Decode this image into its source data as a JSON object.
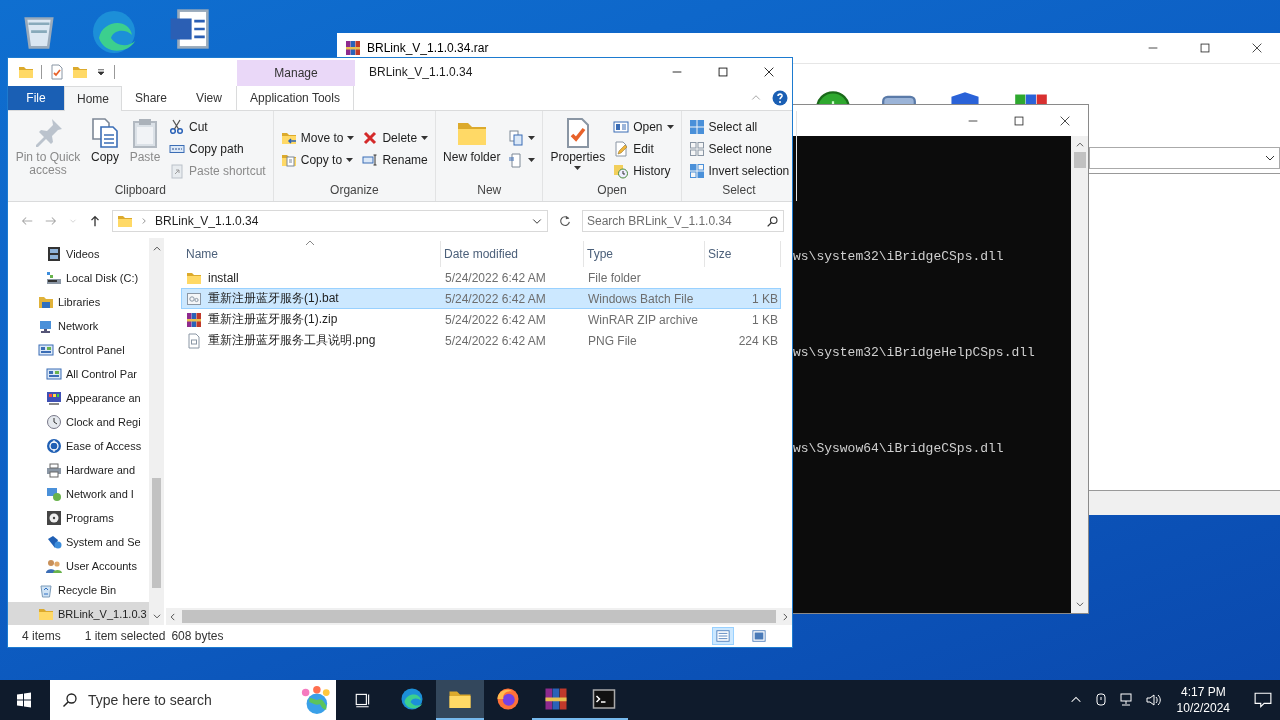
{
  "archive_window": {
    "title": "BRLink_V_1.1.0.34.rar"
  },
  "console_window": {
    "lines": [
      "ws\\system32\\iBridgeCSps.dll",
      "ws\\system32\\iBridgeHelpCSps.dll",
      "ws\\Syswow64\\iBridgeCSps.dll"
    ]
  },
  "explorer": {
    "title": "BRLink_V_1.1.0.34",
    "context_tab": "Manage",
    "tabs": [
      {
        "label": "File",
        "kind": "file",
        "selected": false
      },
      {
        "label": "Home",
        "kind": "normal",
        "selected": true
      },
      {
        "label": "Share",
        "kind": "normal",
        "selected": false
      },
      {
        "label": "View",
        "kind": "normal",
        "selected": false
      },
      {
        "label": "Application Tools",
        "kind": "context",
        "selected": false
      }
    ],
    "ribbon": {
      "groups": [
        {
          "label": "Clipboard",
          "columns": [
            [
              {
                "label": "Pin to Quick access",
                "kind": "large",
                "disabled": true,
                "dropdown": false
              }
            ],
            [
              {
                "label": "Copy",
                "kind": "large",
                "disabled": false,
                "dropdown": false
              }
            ],
            [
              {
                "label": "Paste",
                "kind": "large",
                "disabled": true,
                "dropdown": false
              }
            ],
            [
              {
                "label": "Cut",
                "kind": "small",
                "disabled": false,
                "dropdown": false
              },
              {
                "label": "Copy path",
                "kind": "small",
                "disabled": false,
                "dropdown": false
              },
              {
                "label": "Paste shortcut",
                "kind": "small",
                "disabled": true,
                "dropdown": false
              }
            ]
          ]
        },
        {
          "label": "Organize",
          "columns": [
            [
              {
                "label": "Move to",
                "kind": "small",
                "disabled": false,
                "dropdown": true
              },
              {
                "label": "Copy to",
                "kind": "small",
                "disabled": false,
                "dropdown": true
              }
            ],
            [
              {
                "label": "Delete",
                "kind": "small",
                "disabled": false,
                "dropdown": true
              },
              {
                "label": "Rename",
                "kind": "small",
                "disabled": false,
                "dropdown": false
              }
            ]
          ]
        },
        {
          "label": "New",
          "columns": [
            [
              {
                "label": "New folder",
                "kind": "large",
                "disabled": false,
                "dropdown": false
              }
            ],
            [
              {
                "kind": "icon",
                "disabled": false,
                "dropdown": true
              },
              {
                "kind": "icon",
                "disabled": false,
                "dropdown": true
              }
            ]
          ]
        },
        {
          "label": "Open",
          "columns": [
            [
              {
                "label": "Properties",
                "kind": "large",
                "disabled": false,
                "dropdown": true
              }
            ],
            [
              {
                "label": "Open",
                "kind": "small",
                "disabled": false,
                "dropdown": true
              },
              {
                "label": "Edit",
                "kind": "small",
                "disabled": false,
                "dropdown": false
              },
              {
                "label": "History",
                "kind": "small",
                "disabled": false,
                "dropdown": false
              }
            ]
          ]
        },
        {
          "label": "Select",
          "columns": [
            [
              {
                "label": "Select all",
                "kind": "small",
                "disabled": false,
                "dropdown": false
              },
              {
                "label": "Select none",
                "kind": "small",
                "disabled": false,
                "dropdown": false
              },
              {
                "label": "Invert selection",
                "kind": "small",
                "disabled": false,
                "dropdown": false
              }
            ]
          ]
        }
      ]
    },
    "address": {
      "path": "BRLink_V_1.1.0.34",
      "search_placeholder": "Search BRLink_V_1.1.0.34"
    },
    "nav": {
      "items": [
        {
          "children": [
            {
              "label": "Videos",
              "selected": false
            },
            {
              "label": "Local Disk (C:)",
              "selected": false
            }
          ]
        },
        {
          "label": "Libraries",
          "selected": false
        },
        {
          "label": "Network",
          "selected": false
        },
        {
          "label": "Control Panel",
          "selected": false,
          "children": [
            {
              "label": "All Control Par",
              "selected": false
            },
            {
              "label": "Appearance an",
              "selected": false
            },
            {
              "label": "Clock and Regi",
              "selected": false
            },
            {
              "label": "Ease of Access",
              "selected": false
            },
            {
              "label": "Hardware and",
              "selected": false
            },
            {
              "label": "Network and I",
              "selected": false
            },
            {
              "label": "Programs",
              "selected": false
            },
            {
              "label": "System and Se",
              "selected": false
            },
            {
              "label": "User Accounts",
              "selected": false
            }
          ]
        },
        {
          "label": "Recycle Bin",
          "selected": false
        },
        {
          "label": "BRLink_V_1.1.0.3",
          "selected": true
        }
      ]
    },
    "columns": [
      "Name",
      "Date modified",
      "Type",
      "Size"
    ],
    "files": [
      {
        "name": "install",
        "date": "5/24/2022 6:42 AM",
        "type": "File folder",
        "kind": "folder",
        "selected": false
      },
      {
        "name": "重新注册蓝牙服务(1).bat",
        "date": "5/24/2022 6:42 AM",
        "type": "Windows Batch File",
        "size": "1 KB",
        "kind": "batch",
        "selected": true
      },
      {
        "name": "重新注册蓝牙服务(1).zip",
        "date": "5/24/2022 6:42 AM",
        "type": "WinRAR ZIP archive",
        "size": "1 KB",
        "kind": "archive",
        "selected": false
      },
      {
        "name": "重新注册蓝牙服务工具说明.png",
        "date": "5/24/2022 6:42 AM",
        "type": "PNG File",
        "size": "224 KB",
        "kind": "image",
        "selected": false
      }
    ],
    "status": {
      "count": "4 items",
      "selection": "1 item selected",
      "bytes": "608 bytes",
      "views": [
        {
          "kind": "details",
          "selected": true
        },
        {
          "kind": "large",
          "selected": false
        }
      ]
    }
  },
  "taskbar": {
    "search_placeholder": "Type here to search",
    "apps": [
      {
        "kind": "edge",
        "selected": false,
        "running": false
      },
      {
        "kind": "explorer",
        "selected": true,
        "running": true
      },
      {
        "kind": "firefox",
        "selected": false,
        "running": false
      },
      {
        "kind": "winrar",
        "selected": false,
        "running": true
      },
      {
        "kind": "cmd",
        "selected": false,
        "running": true
      }
    ],
    "time": "4:17 PM",
    "date": "10/2/2024"
  }
}
